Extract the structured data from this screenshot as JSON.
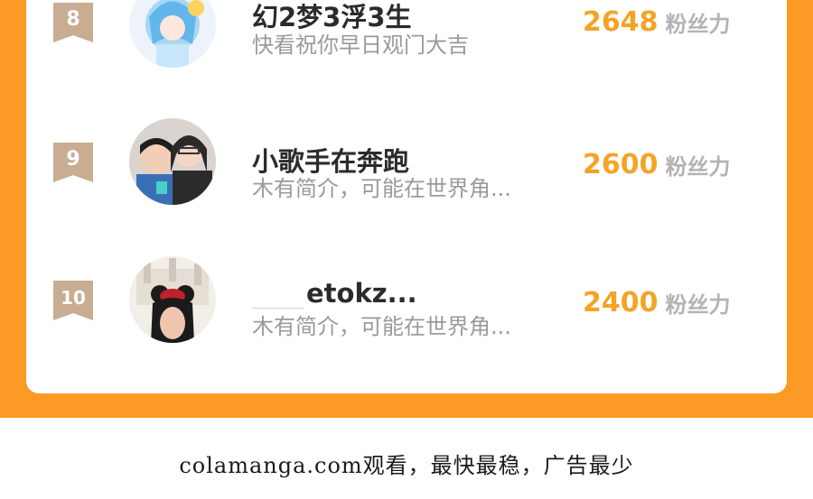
{
  "leaderboard": {
    "rows": [
      {
        "rank": "8",
        "name": "幻2梦3浮3生",
        "bio": "快看祝你早日观门大吉",
        "fans_value": "2648",
        "fans_unit": "粉丝力"
      },
      {
        "rank": "9",
        "name": "小歌手在奔跑",
        "bio": "木有简介，可能在世界角...",
        "fans_value": "2600",
        "fans_unit": "粉丝力"
      },
      {
        "rank": "10",
        "name": "etokz...",
        "bio": "木有简介，可能在世界角...",
        "fans_value": "2400",
        "fans_unit": "粉丝力"
      }
    ]
  },
  "footer": {
    "text": "colamanga.com观看，最快最稳，广告最少"
  },
  "colors": {
    "accent_orange": "#fb9a25",
    "fans_value": "#f3a426",
    "badge": "#c8ad93"
  }
}
